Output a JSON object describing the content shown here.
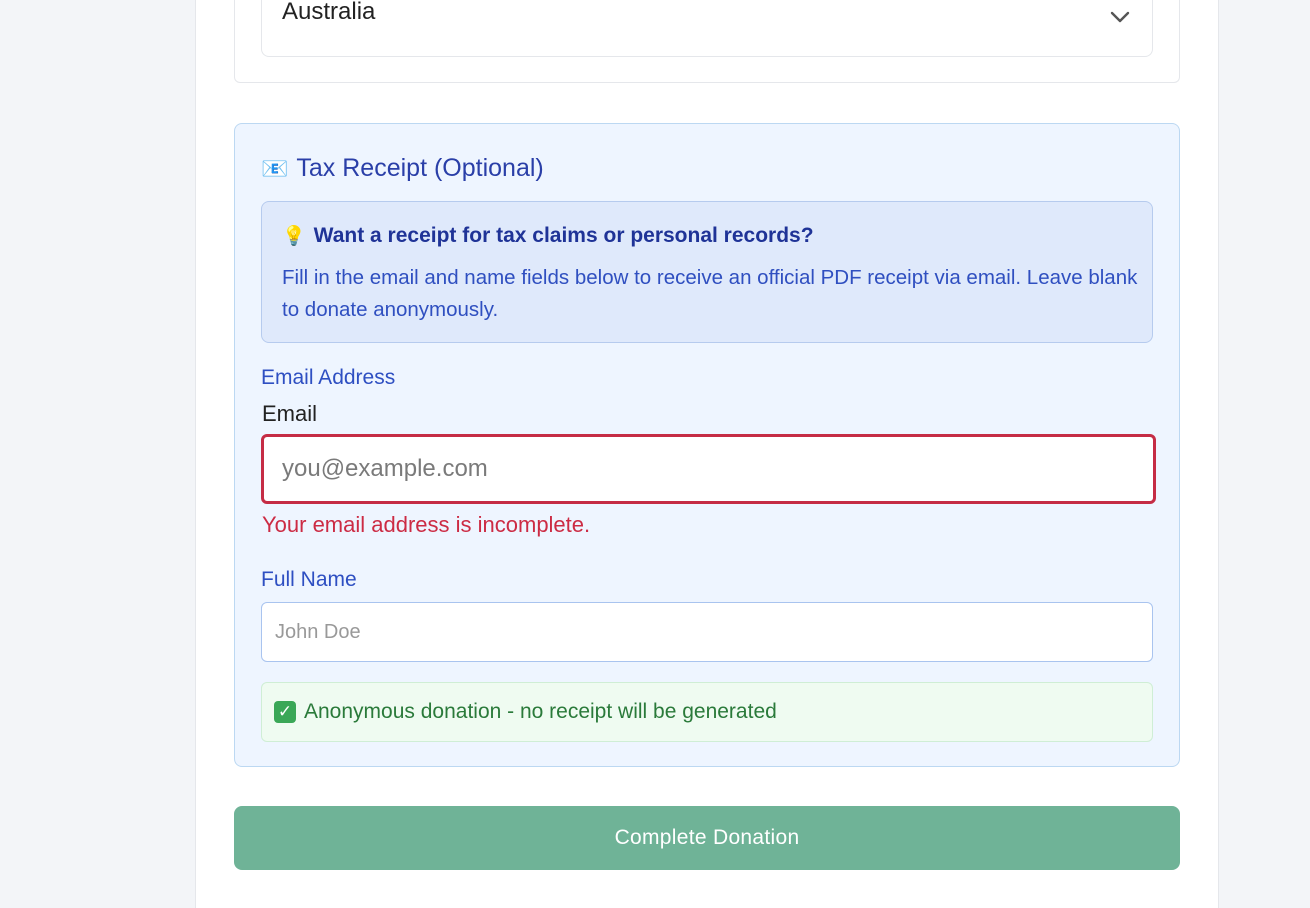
{
  "country": {
    "selected_value": "Australia"
  },
  "tax_receipt": {
    "icon": "envelope-icon",
    "title": "Tax Receipt (Optional)",
    "info": {
      "icon": "lightbulb-icon",
      "heading": "Want a receipt for tax claims or personal records?",
      "body": "Fill in the email and name fields below to receive an official PDF receipt via email. Leave blank to donate anonymously."
    },
    "section_label": "Email Address",
    "email": {
      "label": "Email",
      "placeholder": "you@example.com",
      "value": "",
      "error": "Your email address is incomplete."
    },
    "full_name": {
      "label": "Full Name",
      "placeholder": "John Doe",
      "value": ""
    },
    "anonymous_notice": {
      "icon": "check-icon",
      "text": "Anonymous donation - no receipt will be generated"
    }
  },
  "submit": {
    "label": "Complete Donation"
  },
  "colors": {
    "error": "#c52c45",
    "accent_blue": "#2a3fa8",
    "submit_bg": "#6fb397",
    "success_text": "#2a7a3a"
  }
}
